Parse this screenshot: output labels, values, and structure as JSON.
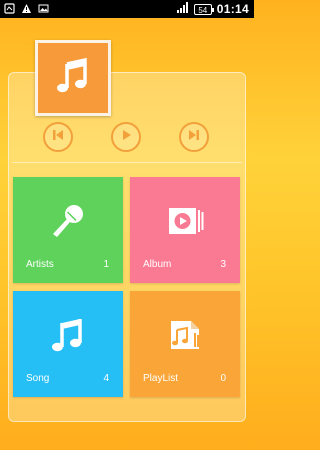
{
  "status_bar": {
    "battery_level": "54",
    "time": "01:14",
    "icons": [
      "notification-icon",
      "warning-icon",
      "image-icon",
      "signal-icon",
      "battery-icon"
    ]
  },
  "player": {
    "album_art_icon": "music-note-icon",
    "controls": [
      "previous-icon",
      "play-icon",
      "next-icon"
    ]
  },
  "library": {
    "tiles": [
      {
        "label": "Artists",
        "count": "1",
        "icon": "microphone-icon",
        "color": "#5fd25c"
      },
      {
        "label": "Album",
        "count": "3",
        "icon": "album-play-icon",
        "color": "#fb7a93"
      },
      {
        "label": "Song",
        "count": "4",
        "icon": "music-note-icon",
        "color": "#25bff5"
      },
      {
        "label": "PlayList",
        "count": "0",
        "icon": "playlist-icon",
        "color": "#f9a538"
      }
    ]
  },
  "colors": {
    "accent_orange": "#f79a3a",
    "background_top": "#ffb21e",
    "background_mid": "#ffd23a"
  }
}
